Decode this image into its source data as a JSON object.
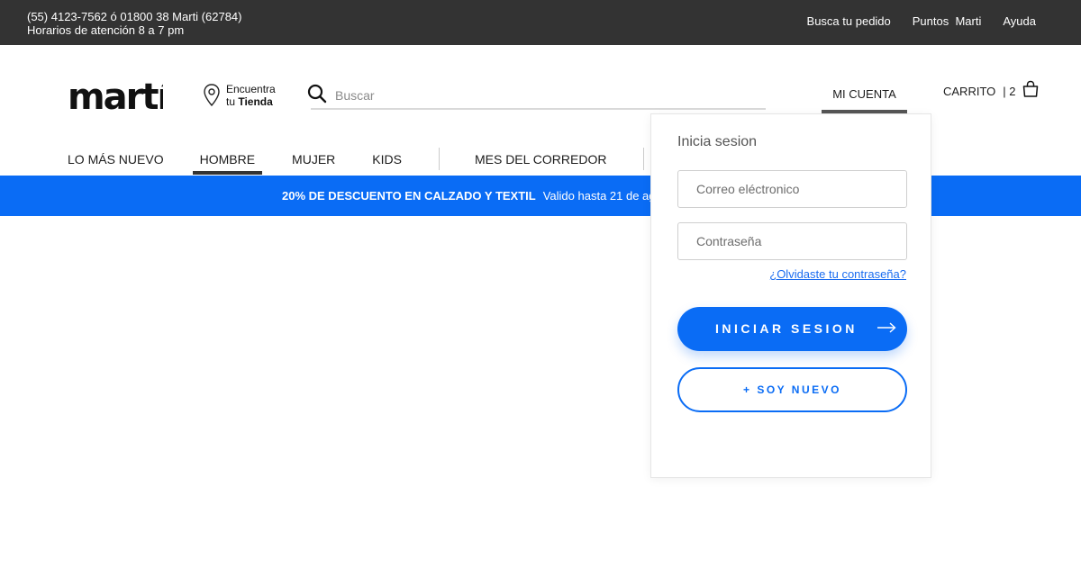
{
  "topbar": {
    "phone": "(55) 4123-7562 ó 01800 38 Marti (62784)",
    "hours": "Horarios de atención 8 a 7 pm",
    "links": {
      "track_order": "Busca tu pedido",
      "points": "Puntos  Marti",
      "help": "Ayuda"
    }
  },
  "header": {
    "logo_text": "martí",
    "store_line1": "Encuentra",
    "store_line2_pre": "tu ",
    "store_line2_bold": "Tienda",
    "search_placeholder": "Buscar",
    "account_label": "MI CUENTA",
    "cart_label": "CARRITO",
    "cart_count": "| 2"
  },
  "nav": {
    "items": [
      "LO MÁS NUEVO",
      "HOMBRE",
      "MUJER",
      "KIDS",
      "MES DEL CORREDOR"
    ],
    "active": "HOMBRE"
  },
  "promo": {
    "bold_text": "20% DE DESCUENTO EN CALZADO Y TEXTIL",
    "text": "Valido hasta 21 de agosto"
  },
  "login": {
    "title": "Inicia sesion",
    "email_placeholder": "Correo eléctronico",
    "password_placeholder": "Contraseña",
    "forgot": "¿Olvidaste tu contraseña?",
    "login_button": "INICIAR SESION",
    "new_button": "+ SOY NUEVO"
  },
  "colors": {
    "topbar_bg": "#333333",
    "accent_blue": "#0a6cf5"
  }
}
